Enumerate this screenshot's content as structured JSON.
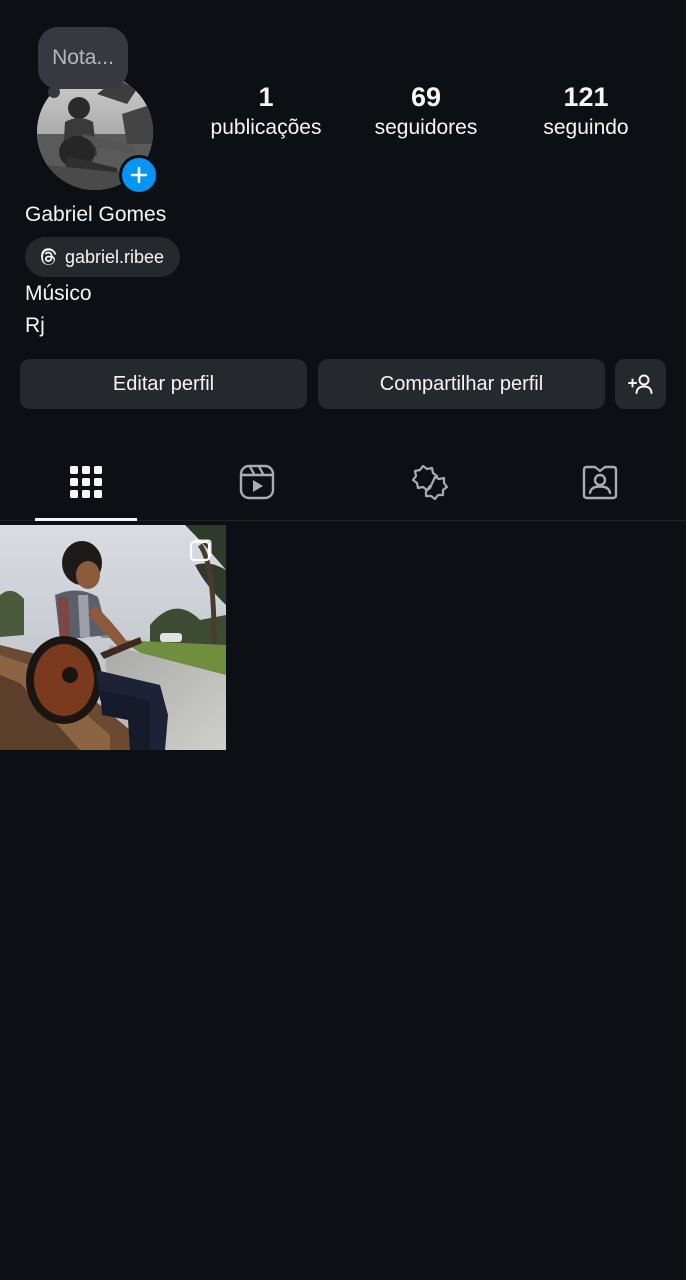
{
  "note": {
    "placeholder": "Nota..."
  },
  "stats": [
    {
      "value": "1",
      "label": "publicações"
    },
    {
      "value": "69",
      "label": "seguidores"
    },
    {
      "value": "121",
      "label": "seguindo"
    }
  ],
  "profile": {
    "name": "Gabriel Gomes",
    "threads_handle": "gabriel.ribee",
    "bio": [
      "Músico",
      "Rj"
    ]
  },
  "buttons": {
    "edit": "Editar perfil",
    "share": "Compartilhar perfil",
    "discover_icon": "add-person-icon"
  },
  "tabs": [
    {
      "icon": "grid-icon",
      "active": true
    },
    {
      "icon": "reels-icon",
      "active": false
    },
    {
      "icon": "collab-icon",
      "active": false
    },
    {
      "icon": "tagged-icon",
      "active": false
    }
  ],
  "colors": {
    "background": "#0c1014",
    "button": "#25292e",
    "accent": "#0095f6",
    "text": "#f5f5f5"
  },
  "posts": [
    {
      "type": "photo-carousel",
      "subject": "guitarist on bench"
    }
  ]
}
